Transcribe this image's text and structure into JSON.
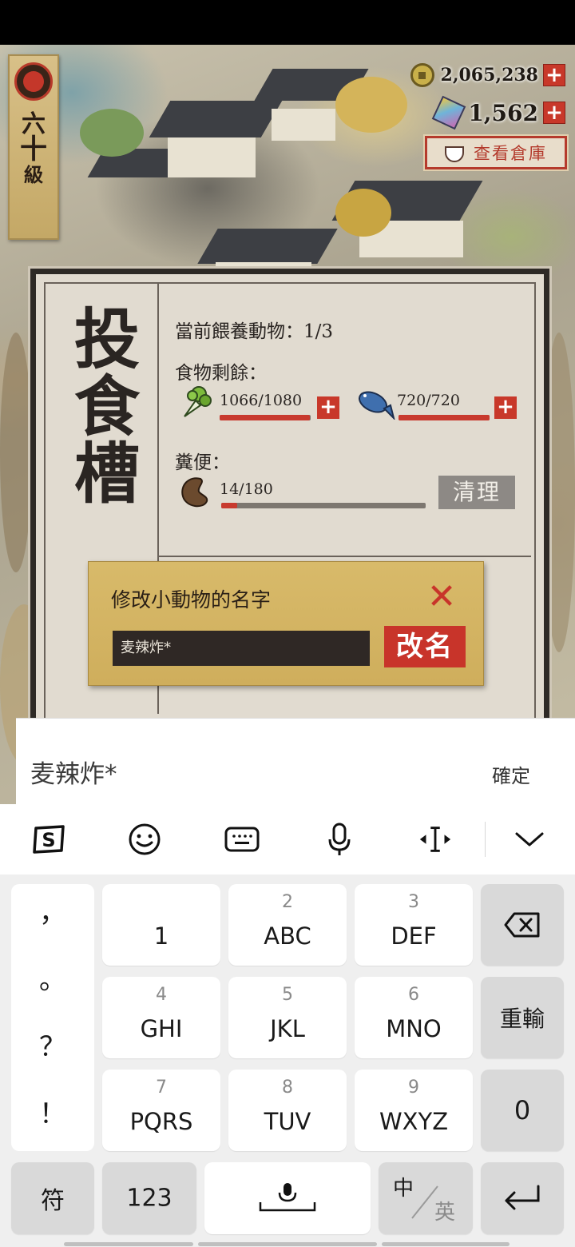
{
  "game": {
    "level": {
      "chars": [
        "六",
        "十",
        "級"
      ]
    },
    "currency": {
      "coins": "2,065,238",
      "gems": "1,562",
      "plus": "+"
    },
    "storage_button": "查看倉庫",
    "trough": {
      "title_chars": [
        "投",
        "食",
        "槽"
      ],
      "feeding_count": "當前餵養動物：1/3",
      "food_label": "食物剩餘：",
      "vegetables": {
        "value": "1066/1080",
        "fill": 0.987
      },
      "fish": {
        "value": "720/720",
        "fill": 1.0
      },
      "manure_label": "糞便：",
      "manure": {
        "value": "14/180",
        "fill": 0.078
      },
      "clean_button": "清理"
    },
    "rename_dialog": {
      "title": "修改小動物的名字",
      "input_value": "麦辣炸*",
      "rename_button": "改名",
      "close": "✕"
    }
  },
  "ime": {
    "composing_text": "麦辣炸*",
    "confirm": "確定",
    "punctuation": [
      "，",
      "。",
      "？",
      "！"
    ],
    "keys": [
      {
        "num": "",
        "label": "1"
      },
      {
        "num": "2",
        "label": "ABC"
      },
      {
        "num": "3",
        "label": "DEF"
      },
      {
        "num": "4",
        "label": "GHI"
      },
      {
        "num": "5",
        "label": "JKL"
      },
      {
        "num": "6",
        "label": "MNO"
      },
      {
        "num": "7",
        "label": "PQRS"
      },
      {
        "num": "8",
        "label": "TUV"
      },
      {
        "num": "9",
        "label": "WXYZ"
      }
    ],
    "reenter": "重輸",
    "zero": "0",
    "symbols": "符",
    "numbers": "123",
    "lang_zh": "中",
    "lang_en": "英",
    "icons": [
      "sogou-icon",
      "emoji-icon",
      "keyboard-icon",
      "microphone-icon",
      "cursor-move-icon",
      "collapse-icon",
      "backspace-icon",
      "space-mic-icon",
      "enter-icon"
    ]
  }
}
